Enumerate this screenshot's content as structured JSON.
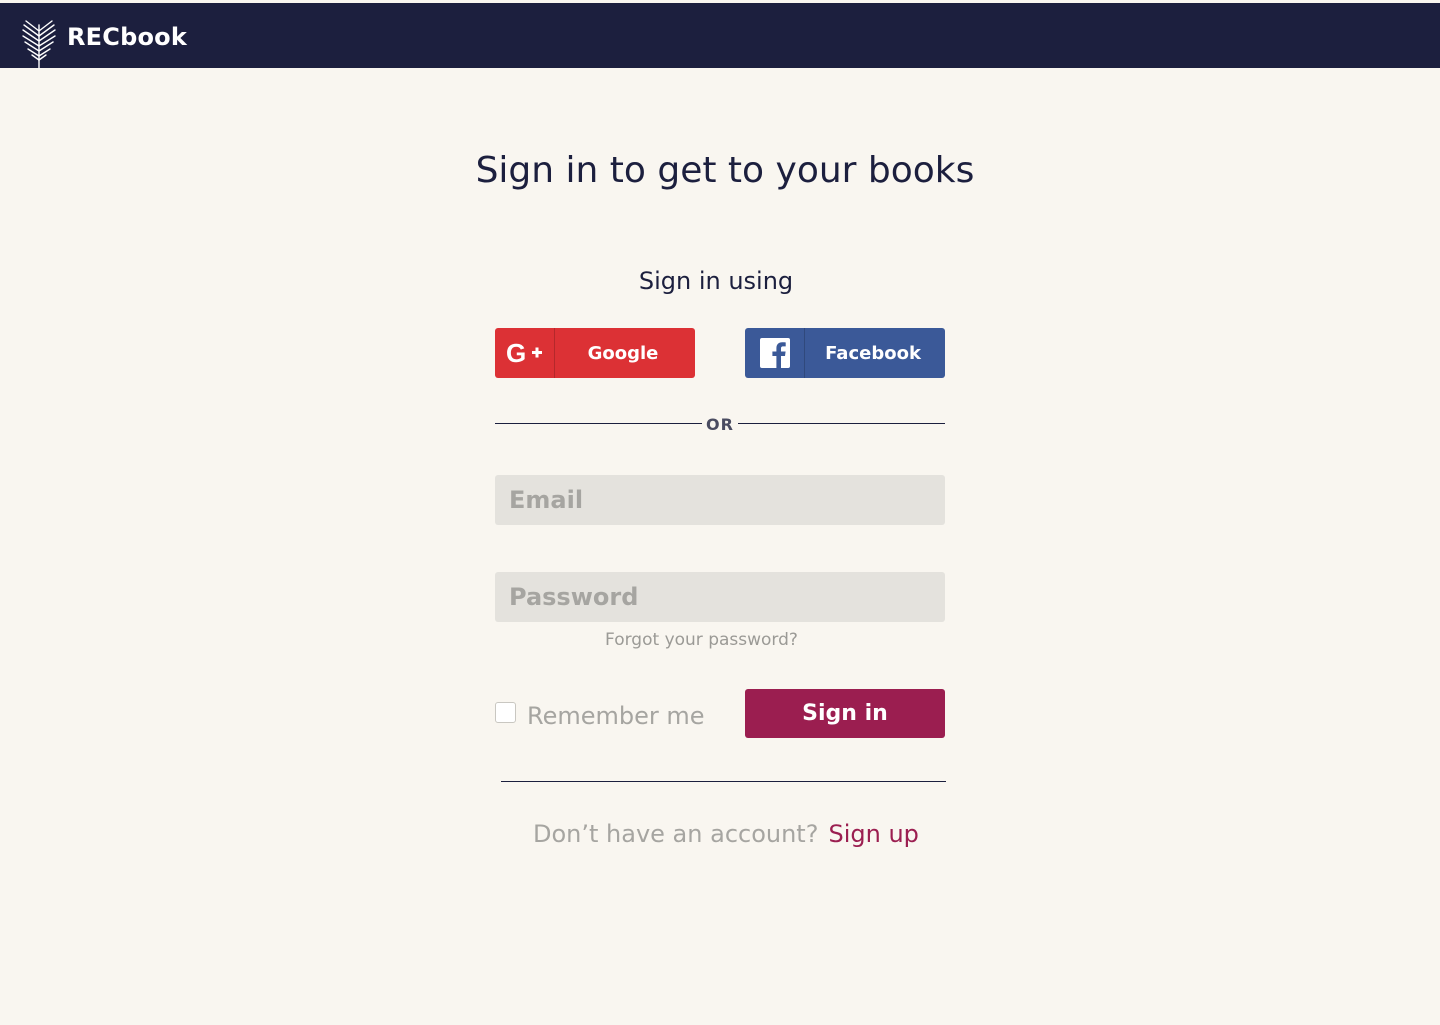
{
  "header": {
    "brand": "RECbook",
    "logo_icon": "palm-leaf-icon",
    "background": "#1c1f3e"
  },
  "main": {
    "title": "Sign in to get to your books",
    "signin_using": "Sign in using",
    "social": {
      "google": {
        "label": "Google",
        "icon": "google-plus-icon",
        "color": "#dc3135"
      },
      "facebook": {
        "label": "Facebook",
        "icon": "facebook-icon",
        "color": "#3b5998"
      }
    },
    "or_text": "OR",
    "email": {
      "placeholder": "Email",
      "value": ""
    },
    "password": {
      "placeholder": "Password",
      "value": ""
    },
    "forgot": "Forgot your password?",
    "remember": {
      "label": "Remember me",
      "checked": false
    },
    "signin_button": "Sign in",
    "accent": "#9b1e50",
    "footer": {
      "question": "Don’t have an account?",
      "signup": "Sign up"
    }
  }
}
